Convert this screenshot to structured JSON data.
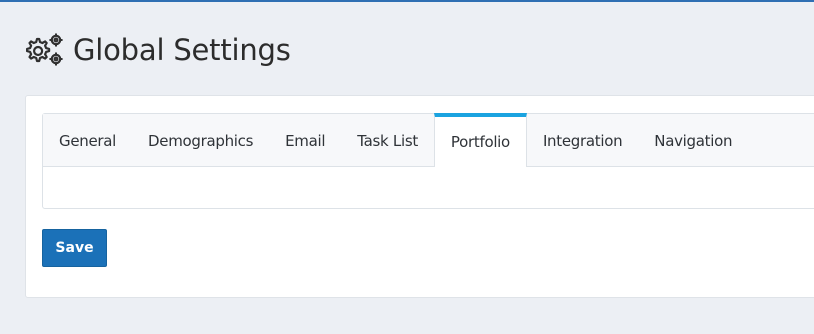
{
  "page": {
    "title": "Global Settings",
    "title_icon": "gears-icon"
  },
  "tabs": [
    {
      "label": "General",
      "active": false
    },
    {
      "label": "Demographics",
      "active": false
    },
    {
      "label": "Email",
      "active": false
    },
    {
      "label": "Task List",
      "active": false
    },
    {
      "label": "Portfolio",
      "active": true
    },
    {
      "label": "Integration",
      "active": false
    },
    {
      "label": "Navigation",
      "active": false
    }
  ],
  "actions": {
    "save_label": "Save"
  },
  "colors": {
    "page_background": "#eceff4",
    "top_border": "#2f6fb3",
    "active_tab_accent": "#1aa3e0",
    "save_button": "#1b71b8"
  }
}
